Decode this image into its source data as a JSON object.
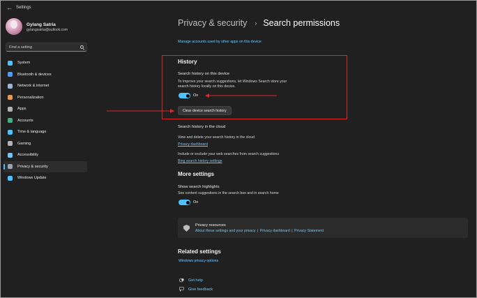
{
  "app": {
    "title": "Settings"
  },
  "user": {
    "name": "Gylang Satria",
    "email": "gylangsatria@outlook.com"
  },
  "search": {
    "placeholder": "Find a setting"
  },
  "sidebar": {
    "items": [
      {
        "label": "System",
        "icon": "system-icon",
        "color": "#4cc2ff",
        "active": false
      },
      {
        "label": "Bluetooth & devices",
        "icon": "bluetooth-icon",
        "color": "#4c9bff",
        "active": false
      },
      {
        "label": "Network & internet",
        "icon": "wifi-icon",
        "color": "#9ab5d6",
        "active": false
      },
      {
        "label": "Personalization",
        "icon": "brush-icon",
        "color": "#e79a55",
        "active": false
      },
      {
        "label": "Apps",
        "icon": "apps-icon",
        "color": "#b3b3b3",
        "active": false
      },
      {
        "label": "Accounts",
        "icon": "accounts-icon",
        "color": "#3fb37f",
        "active": false
      },
      {
        "label": "Time & language",
        "icon": "globe-clock-icon",
        "color": "#4cc2ff",
        "active": false
      },
      {
        "label": "Gaming",
        "icon": "controller-icon",
        "color": "#b3b3b3",
        "active": false
      },
      {
        "label": "Accessibility",
        "icon": "accessibility-icon",
        "color": "#6ec6ff",
        "active": false
      },
      {
        "label": "Privacy & security",
        "icon": "shield-icon",
        "color": "#9aa4b1",
        "active": true
      },
      {
        "label": "Windows Update",
        "icon": "update-icon",
        "color": "#4cc2ff",
        "active": false
      }
    ]
  },
  "breadcrumb": {
    "parent": "Privacy & security",
    "separator": "›",
    "current": "Search permissions"
  },
  "main": {
    "top_link": "Manage accounts used by other apps on this device",
    "history": {
      "title": "History",
      "subtitle": "Search history on this device",
      "description_line1": "To improve your search suggestions, let Windows Search store your",
      "description_line2": "search history locally on this device.",
      "toggle_state": "On",
      "clear_button": "Clear device search history"
    },
    "cloud": {
      "title": "Search history in the cloud",
      "view_desc": "View and delete your search history in the cloud",
      "privacy_dashboard": "Privacy dashboard",
      "include_desc": "Include or exclude your web searches from search suggestions",
      "bing_link": "Bing search history settings"
    },
    "more": {
      "title": "More settings",
      "subtitle": "Show search highlights",
      "description": "See content suggestions in the search box and in search home",
      "toggle_state": "On"
    },
    "privacy_resources": {
      "title": "Privacy resources",
      "link1": "About these settings and your privacy",
      "sep": "|",
      "link2": "Privacy dashboard",
      "link3": "Privacy Statement"
    },
    "related": {
      "title": "Related settings",
      "link": "Windows privacy options"
    },
    "help": {
      "get_help": "Get help",
      "give_feedback": "Give feedback"
    }
  },
  "annotation": {
    "highlight_color": "#e0262b"
  }
}
